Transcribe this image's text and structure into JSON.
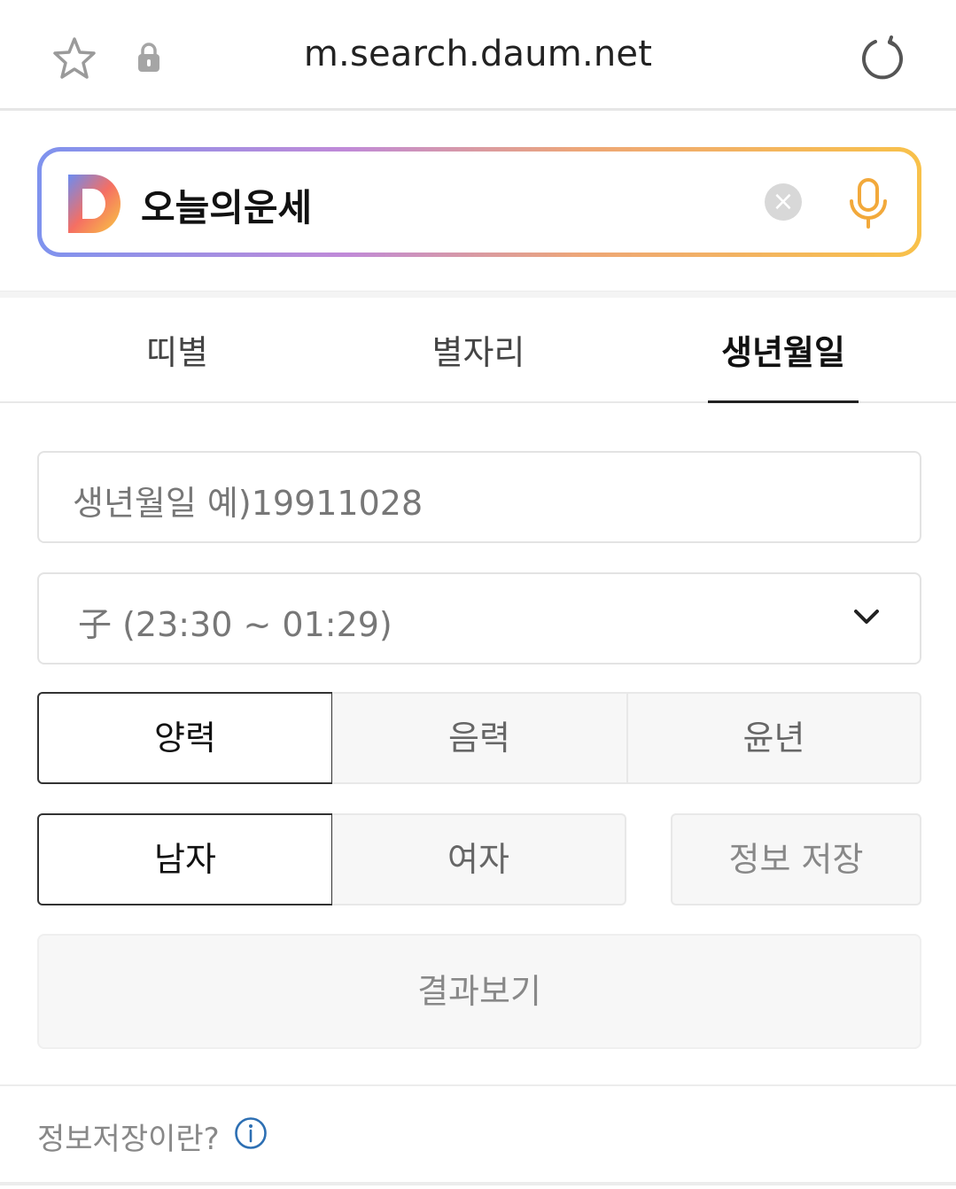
{
  "browser": {
    "url": "m.search.daum.net",
    "icons": [
      "star-icon",
      "lock-icon",
      "reload-icon"
    ]
  },
  "search": {
    "query": "오늘의운세",
    "clear_label": "×",
    "icons": [
      "daum-logo-icon",
      "microphone-icon"
    ],
    "colors": {
      "gradient_start": "#7f93ee",
      "gradient_mid": "#c08ad8",
      "gradient_end": "#f8c14a",
      "mic": "#f2a93b"
    }
  },
  "tabs": [
    {
      "label": "띠별",
      "active": false
    },
    {
      "label": "별자리",
      "active": false
    },
    {
      "label": "생년월일",
      "active": true
    }
  ],
  "form": {
    "birth_placeholder": "생년월일 예)19911028",
    "birth_value": "",
    "time_select": "子 (23:30 ~ 01:29)",
    "calendar_options": [
      {
        "label": "양력",
        "selected": true
      },
      {
        "label": "음력",
        "selected": false
      },
      {
        "label": "윤년",
        "selected": false
      }
    ],
    "gender_options": [
      {
        "label": "남자",
        "selected": true
      },
      {
        "label": "여자",
        "selected": false
      }
    ],
    "save_info_label": "정보 저장",
    "result_label": "결과보기"
  },
  "footer": {
    "info_text": "정보저장이란?",
    "info_icon": "info-icon",
    "info_icon_color": "#2d6fb3"
  }
}
